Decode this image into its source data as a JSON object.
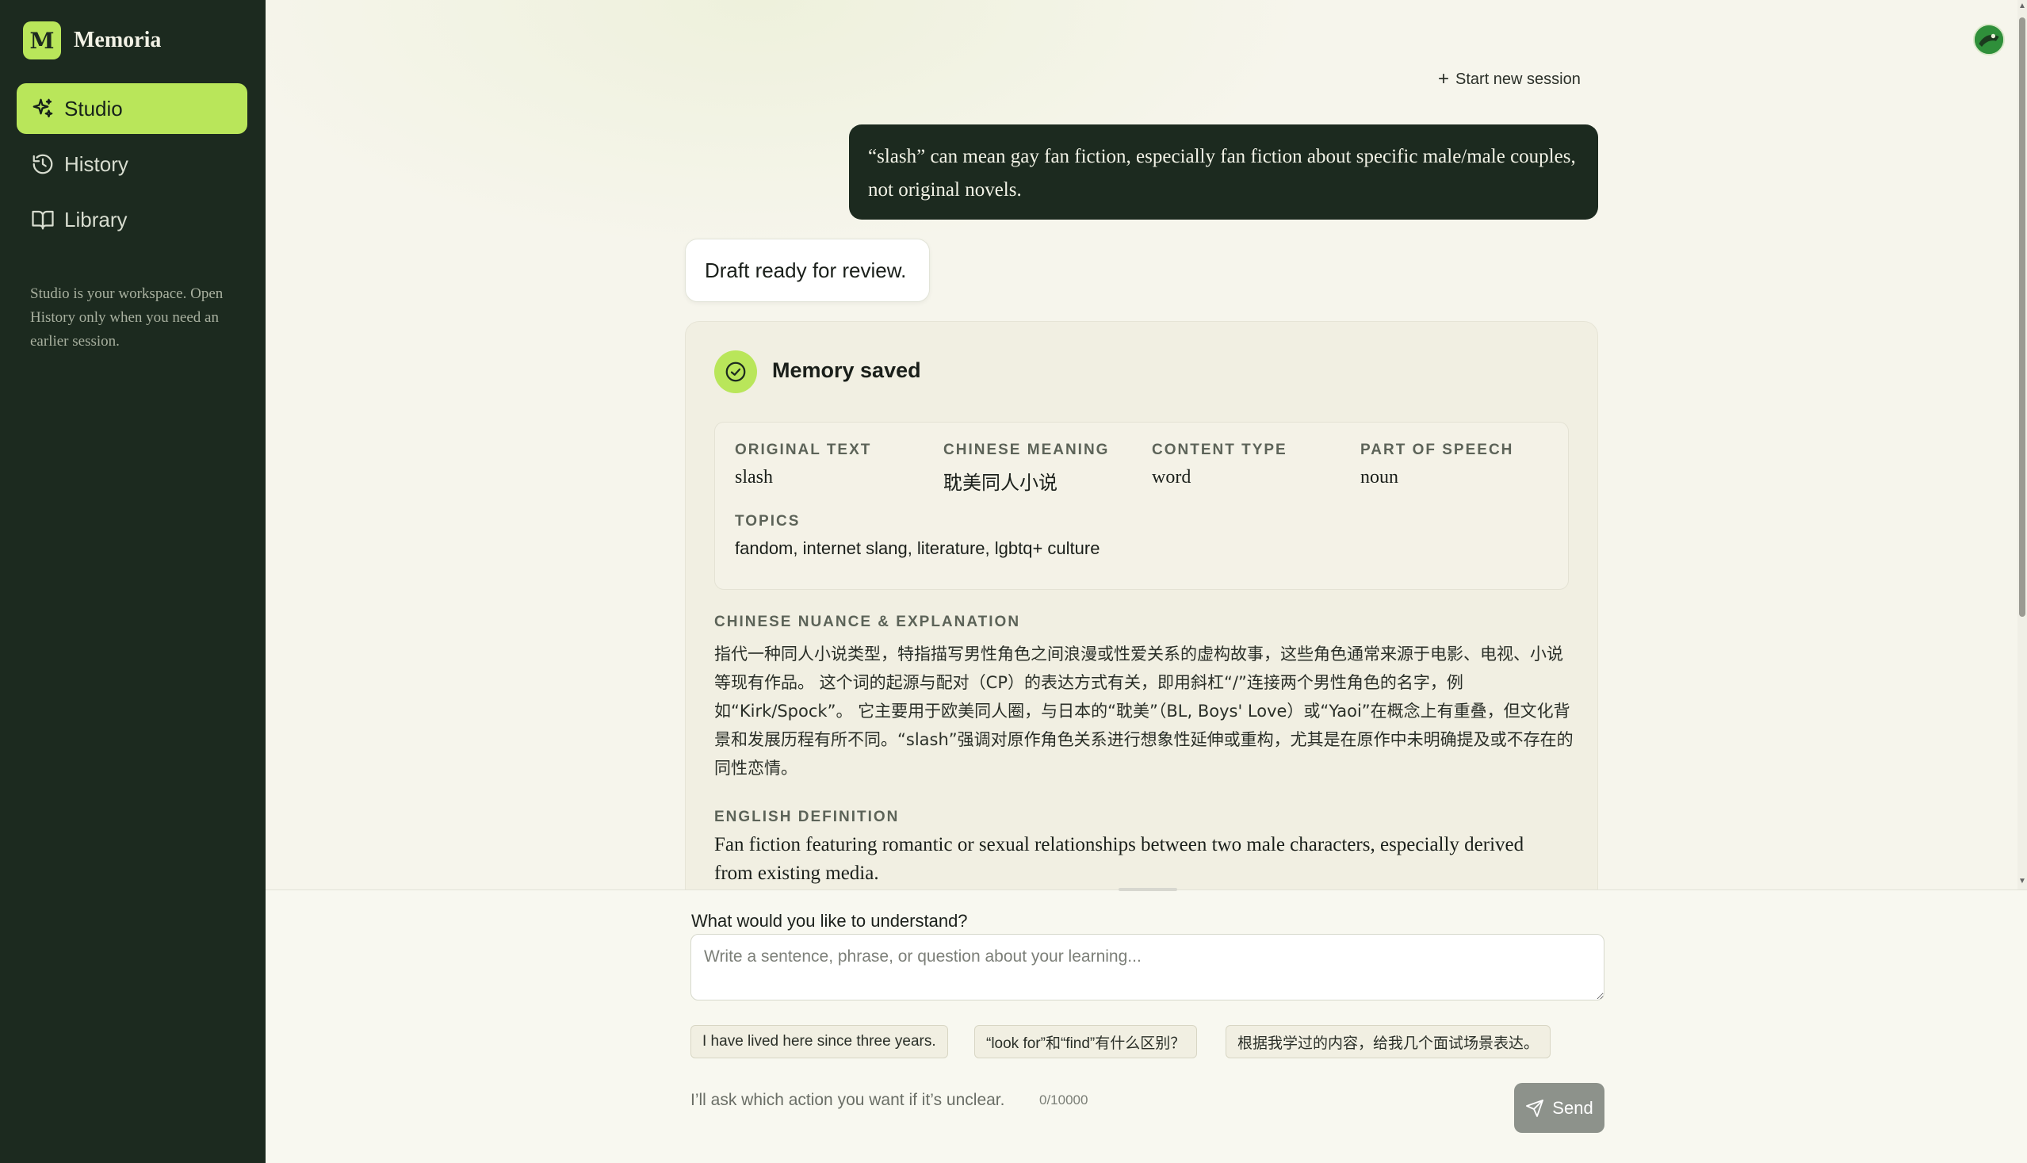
{
  "app": {
    "logo_letter": "M",
    "name": "Memoria"
  },
  "sidebar": {
    "items": [
      {
        "label": "Studio",
        "icon": "sparkles-icon",
        "active": true
      },
      {
        "label": "History",
        "icon": "history-icon",
        "active": false
      },
      {
        "label": "Library",
        "icon": "book-icon",
        "active": false
      }
    ],
    "hint": "Studio is your workspace. Open History only when you need an earlier session."
  },
  "header": {
    "new_session_label": "Start new session"
  },
  "chat": {
    "user_message": "“slash” can mean gay fan fiction, especially fan fiction about specific male/male couples, not original novels.",
    "status_message": "Draft ready for review."
  },
  "memory": {
    "title": "Memory saved",
    "fields": {
      "original_text": {
        "label": "ORIGINAL TEXT",
        "value": "slash"
      },
      "chinese_meaning": {
        "label": "CHINESE MEANING",
        "value": "耽美同人小说"
      },
      "content_type": {
        "label": "CONTENT TYPE",
        "value": "word"
      },
      "part_of_speech": {
        "label": "PART OF SPEECH",
        "value": "noun"
      },
      "topics": {
        "label": "TOPICS",
        "value": "fandom, internet slang, literature, lgbtq+ culture"
      }
    },
    "nuance_label": "CHINESE NUANCE & EXPLANATION",
    "nuance_lines": [
      "指代一种同人小说类型，特指描写男性角色之间浪漫或性爱关系的虚构故事，这些角色通常来源于电影、电视、小说",
      "等现有作品。 这个词的起源与配对（CP）的表达方式有关，即用斜杠“/”连接两个男性角色的名字，例",
      "如“Kirk/Spock”。 它主要用于欧美同人圈，与日本的“耽美”（BL, Boys' Love）或“Yaoi”在概念上有重叠，但文化背",
      "景和发展历程有所不同。“slash”强调对原作角色关系进行想象性延伸或重构，尤其是在原作中未明确提及或不存在的",
      "同性恋情。"
    ],
    "definition_label": "ENGLISH DEFINITION",
    "definition_lines": [
      "Fan fiction featuring romantic or sexual relationships between two male characters, especially derived",
      "from existing media."
    ]
  },
  "composer": {
    "label": "What would you like to understand?",
    "placeholder": "Write a sentence, phrase, or question about your learning...",
    "value": "",
    "suggestions": [
      "I have lived here since three years.",
      "“look for”和“find”有什么区别？",
      "根据我学过的内容，给我几个面试场景表达。"
    ],
    "hint": "I’ll ask which action you want if it’s unclear.",
    "counter": "0/10000",
    "send_label": "Send"
  },
  "colors": {
    "sidebar_bg": "#1c2a1f",
    "accent": "#b9e65a",
    "send_button": "#8d928b"
  }
}
